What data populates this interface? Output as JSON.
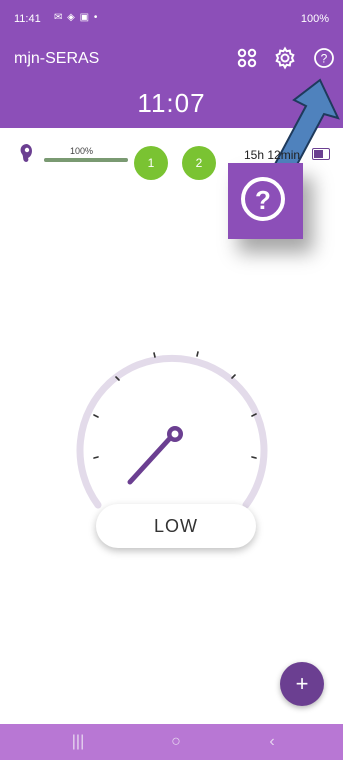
{
  "status": {
    "time": "11:41",
    "icons": "✉ ◈ ▣ •",
    "right": "100%"
  },
  "header": {
    "title": "mjn-SERAS",
    "clock": "11:07",
    "icons": [
      "apps-grid-icon",
      "settings-gear-icon",
      "help-icon"
    ]
  },
  "device": {
    "volume_label": "100%",
    "volume_level": 1.0,
    "programs": [
      "1",
      "2"
    ],
    "battery_time": "15h 12min",
    "program_color": "#7ac332"
  },
  "dial": {
    "level_label": "LOW"
  },
  "fab": {
    "label": "+"
  },
  "navbar": {
    "recent": "|||",
    "home": "○",
    "back": "‹"
  },
  "colors": {
    "brand": "#8c4fb8",
    "accent": "#6b3f91",
    "navbar": "#b877d4",
    "arrow": "#4f82bd"
  }
}
